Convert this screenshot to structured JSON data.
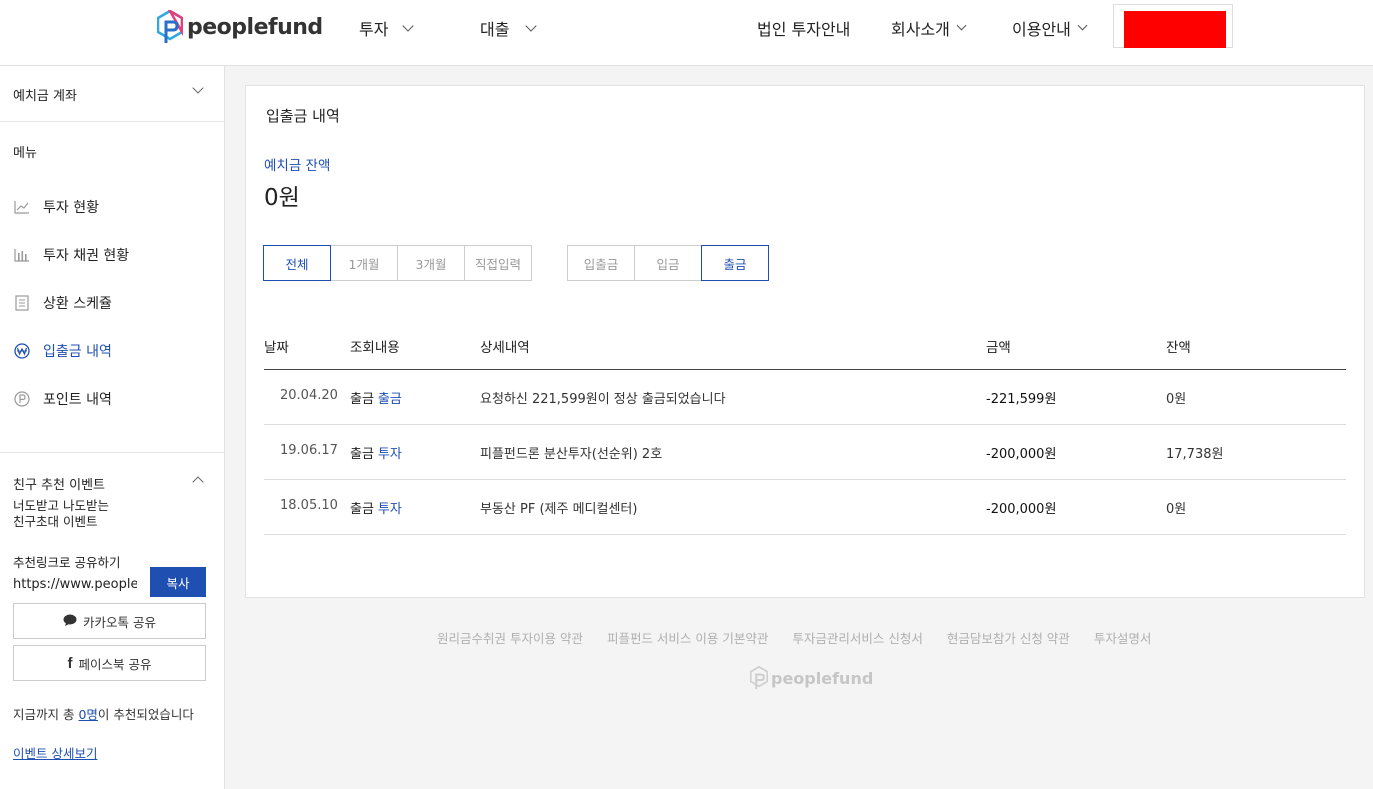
{
  "header": {
    "logo_text": "peoplefund",
    "nav": [
      "투자",
      "대출",
      "법인 투자안내",
      "회사소개",
      "이용안내"
    ]
  },
  "sidebar": {
    "account_label": "예치금 계좌",
    "menu_title": "메뉴",
    "items": [
      {
        "label": "투자 현황",
        "icon": "line-chart-icon"
      },
      {
        "label": "투자 채권 현황",
        "icon": "bar-chart-icon"
      },
      {
        "label": "상환 스케쥴",
        "icon": "document-icon"
      },
      {
        "label": "입출금 내역",
        "icon": "won-icon",
        "active": true
      },
      {
        "label": "포인트 내역",
        "icon": "point-icon"
      }
    ],
    "event": {
      "title": "친구 추천 이벤트",
      "subtitle_line1": "너도받고 나도받는",
      "subtitle_line2": "친구초대 이벤트",
      "share_label": "추천링크로 공유하기",
      "share_url": "https://www.peoplefund.co.kr",
      "copy_label": "복사",
      "kakao_label": "카카오톡 공유",
      "facebook_label": "페이스북 공유",
      "reco_prefix": "지금까지 총 ",
      "reco_count": "0명",
      "reco_suffix": "이 추천되었습니다",
      "detail_link": "이벤트 상세보기"
    }
  },
  "main": {
    "title": "입출금 내역",
    "balance_label": "예치금 잔액",
    "balance_value": "0원",
    "period_filters": [
      "전체",
      "1개월",
      "3개월",
      "직접입력"
    ],
    "type_filters": [
      "입출금",
      "입금",
      "출금"
    ],
    "table": {
      "headers": [
        "날짜",
        "조회내용",
        "상세내역",
        "금액",
        "잔액"
      ],
      "rows": [
        {
          "date": "20.04.20",
          "kind": "출금",
          "sub": "출금",
          "detail": "요청하신 221,599원이 정상 출금되었습니다",
          "amount": "-221,599원",
          "balance": "0원"
        },
        {
          "date": "19.06.17",
          "kind": "출금",
          "sub": "투자",
          "detail": "피플펀드론 분산투자(선순위) 2호",
          "amount": "-200,000원",
          "balance": "17,738원"
        },
        {
          "date": "18.05.10",
          "kind": "출금",
          "sub": "투자",
          "detail": "부동산 PF (제주 메디컬센터)",
          "amount": "-200,000원",
          "balance": "0원"
        }
      ]
    }
  },
  "footer": {
    "links": [
      "원리금수취권 투자이용 약관",
      "피플펀드 서비스 이용 기본약관",
      "투자금관리서비스 신청서",
      "현금담보참가 신청 약관",
      "투자설명서"
    ],
    "logo_text": "peoplefund"
  },
  "colors": {
    "accent": "#1f4fb0",
    "redaction": "#ff0000"
  }
}
